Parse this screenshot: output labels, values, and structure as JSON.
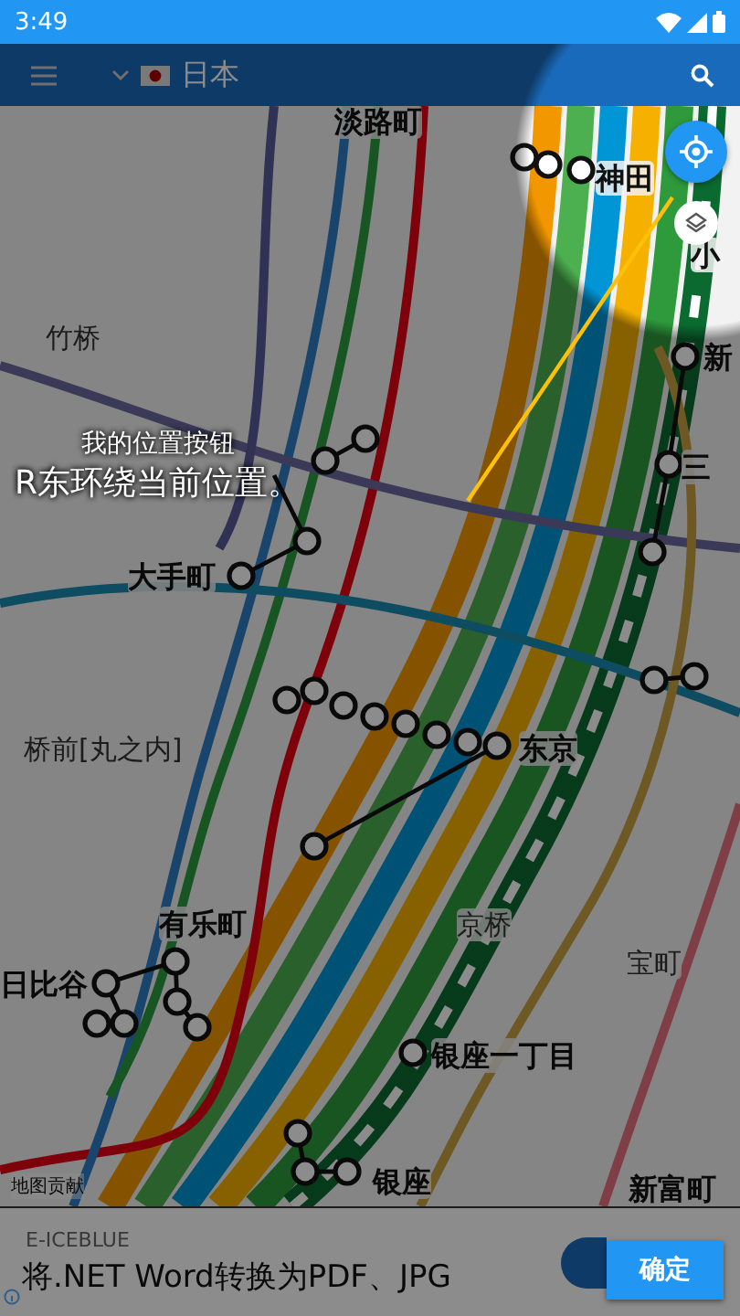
{
  "status_bar": {
    "time": "3:49"
  },
  "app_bar": {
    "region": "日本"
  },
  "map": {
    "stations": [
      {
        "name": "淡路町",
        "kind": "major"
      },
      {
        "name": "神田",
        "kind": "major"
      },
      {
        "name": "小",
        "kind": "major"
      },
      {
        "name": "竹桥",
        "kind": "minor"
      },
      {
        "name": "新",
        "kind": "major"
      },
      {
        "name": "三",
        "kind": "major"
      },
      {
        "name": "大手町",
        "kind": "major"
      },
      {
        "name": "桥前[丸之内]",
        "kind": "minor"
      },
      {
        "name": "东京",
        "kind": "major"
      },
      {
        "name": "京桥",
        "kind": "minor"
      },
      {
        "name": "宝町",
        "kind": "minor"
      },
      {
        "name": "有乐町",
        "kind": "major"
      },
      {
        "name": "日比谷",
        "kind": "major"
      },
      {
        "name": "银座一丁目",
        "kind": "major"
      },
      {
        "name": "银座",
        "kind": "major"
      },
      {
        "name": "新富町",
        "kind": "major"
      }
    ],
    "attribution": "地图贡献"
  },
  "coach_mark": {
    "title": "我的位置按钮",
    "text": "R东环绕当前位置。"
  },
  "ad": {
    "advertiser": "E-ICEBLUE",
    "headline": "将.NET Word转换为PDF、JPG"
  },
  "confirm_button": "确定"
}
